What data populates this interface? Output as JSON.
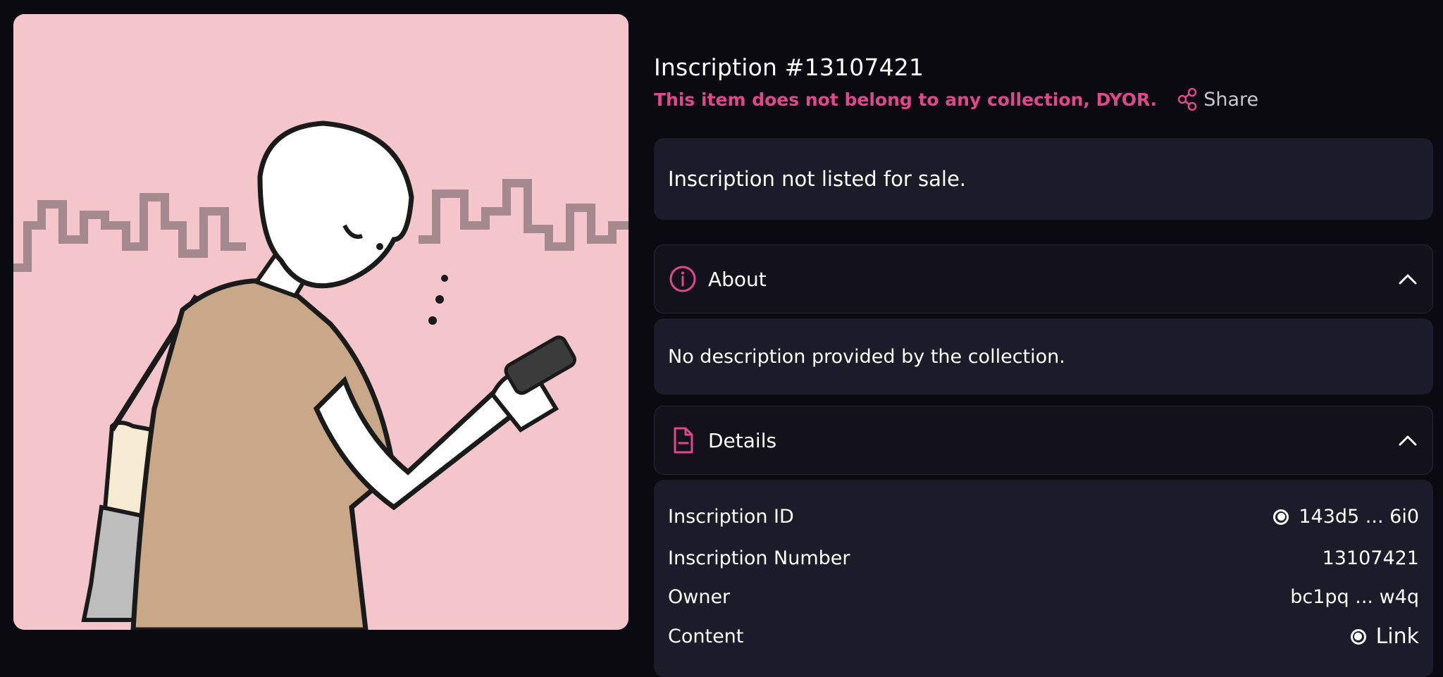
{
  "artwork": {
    "alt": "person-looking-at-phone-artwork",
    "background_color": "#f4c6cc"
  },
  "inscription": {
    "title": "Inscription #13107421",
    "warning": "This item does not belong to any collection, DYOR.",
    "share_label": "Share"
  },
  "sale": {
    "status": "Inscription not listed for sale."
  },
  "about": {
    "heading": "About",
    "description": "No description provided by the collection."
  },
  "details": {
    "heading": "Details",
    "rows": [
      {
        "label": "Inscription ID",
        "value": "143d5 ... 6i0"
      },
      {
        "label": "Inscription Number",
        "value": "13107421"
      },
      {
        "label": "Owner",
        "value": "bc1pq ... w4q"
      },
      {
        "label": "Content",
        "value": "Link"
      }
    ]
  },
  "colors": {
    "accent": "#e1478b",
    "background": "#0b0a10",
    "panel": "#1c1b29",
    "header": "#13121b"
  },
  "icons": {
    "share": "share-icon",
    "about": "info-icon",
    "details": "document-icon",
    "collapse": "chevron-up-icon",
    "radio": "radio-icon"
  }
}
